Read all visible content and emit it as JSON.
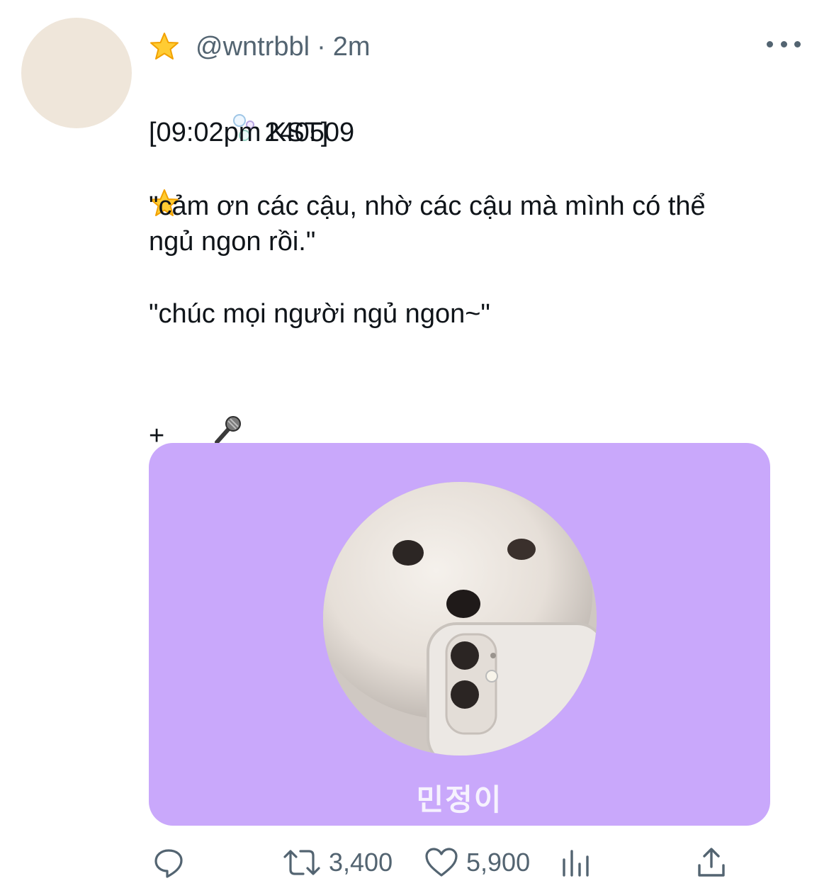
{
  "tweet": {
    "author_handle": "@wntrbbl",
    "separator": "·",
    "time_ago": "2m",
    "lines": {
      "date": "240509",
      "time": "[09:02pm KST]",
      "quote1": "\"cảm ơn các cậu, nhờ các cậu mà mình có thể\nngủ ngon rồi.\"",
      "quote2": "\"chúc mọi người ngủ ngon~\"",
      "plus": "+"
    },
    "icons": {
      "header_emoji": "star-emoji-icon",
      "line_emoji_1": "star-emoji-icon",
      "line_emoji_2": "bubbles-emoji-icon",
      "tail_emoji": "microphone-emoji-icon"
    },
    "media": {
      "caption": "민정이",
      "background_color": "#c9a8fb"
    },
    "actions": {
      "reply": {
        "icon": "reply-icon",
        "count": ""
      },
      "retweet": {
        "icon": "retweet-icon",
        "count": "3,400"
      },
      "like": {
        "icon": "heart-icon",
        "count": "5,900"
      },
      "views": {
        "icon": "analytics-icon"
      },
      "share": {
        "icon": "share-icon"
      }
    }
  },
  "colors": {
    "text_primary": "#0f1419",
    "text_secondary": "#536471",
    "avatar_bg": "#efe6da"
  }
}
